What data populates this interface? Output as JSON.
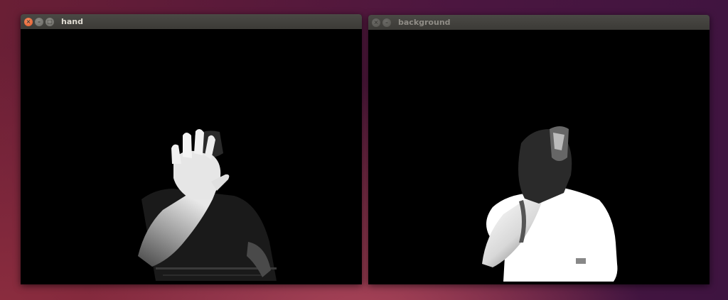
{
  "windows": [
    {
      "title": "hand",
      "active": true,
      "icons": [
        "close-icon",
        "minimize-icon",
        "maximize-icon"
      ],
      "content": "mask image: isolated hand and forearm in white on black"
    },
    {
      "title": "background",
      "active": false,
      "icons": [
        "close-icon",
        "minimize-icon"
      ],
      "content": "mask image: torso silhouette in white on black"
    }
  ],
  "colors": {
    "titlebar": "#3c3b37",
    "close_button": "#e35a2a",
    "window_content": "#000000",
    "mask_foreground": "#ffffff"
  }
}
